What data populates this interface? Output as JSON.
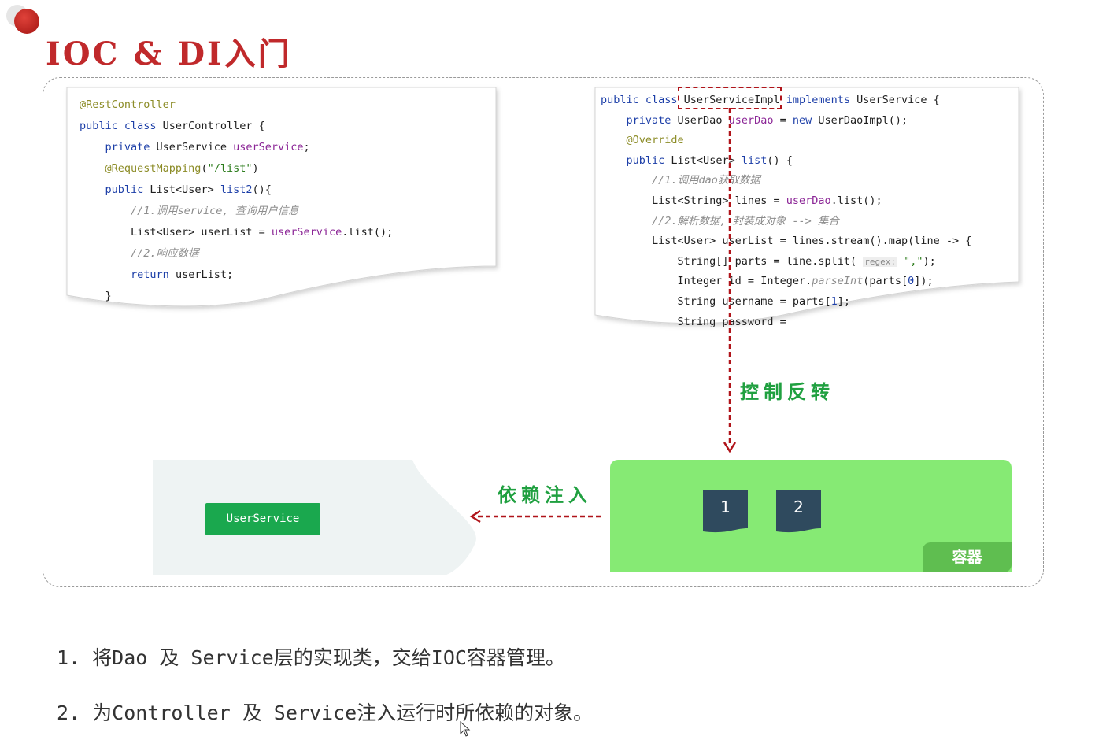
{
  "title": "IOC & DI入门",
  "left_code": {
    "lines": [
      [
        {
          "c": "an",
          "t": "@RestController"
        }
      ],
      [
        {
          "c": "kw",
          "t": "public class "
        },
        {
          "c": "",
          "t": "UserController {"
        }
      ],
      [
        {
          "c": "",
          "t": "    "
        },
        {
          "c": "kw",
          "t": "private "
        },
        {
          "c": "",
          "t": "UserService "
        },
        {
          "c": "fld",
          "t": "userService"
        },
        {
          "c": "",
          "t": ";"
        }
      ],
      [
        {
          "c": "",
          "t": "    "
        },
        {
          "c": "an",
          "t": "@RequestMapping"
        },
        {
          "c": "",
          "t": "("
        },
        {
          "c": "str",
          "t": "\"/list\""
        },
        {
          "c": "",
          "t": ")"
        }
      ],
      [
        {
          "c": "",
          "t": "    "
        },
        {
          "c": "kw",
          "t": "public "
        },
        {
          "c": "",
          "t": "List<User> "
        },
        {
          "c": "kw",
          "t": "list2"
        },
        {
          "c": "",
          "t": "(){"
        }
      ],
      [
        {
          "c": "",
          "t": "        "
        },
        {
          "c": "cm",
          "t": "//1.调用service, 查询用户信息"
        }
      ],
      [
        {
          "c": "",
          "t": "        List<User> userList = "
        },
        {
          "c": "fld",
          "t": "userService"
        },
        {
          "c": "",
          "t": ".list();"
        }
      ],
      [
        {
          "c": "",
          "t": "        "
        },
        {
          "c": "cm",
          "t": "//2.响应数据"
        }
      ],
      [
        {
          "c": "",
          "t": "        "
        },
        {
          "c": "kw",
          "t": "return "
        },
        {
          "c": "",
          "t": "userList;"
        }
      ],
      [
        {
          "c": "",
          "t": "    }"
        }
      ]
    ]
  },
  "right_code": {
    "highlight": "UserServiceImpl",
    "lines": [
      [
        {
          "c": "kw",
          "t": "public class "
        },
        {
          "c": "",
          "t": "UserServiceImpl "
        },
        {
          "c": "kw",
          "t": "implements "
        },
        {
          "c": "",
          "t": "UserService {"
        }
      ],
      [
        {
          "c": "",
          "t": "    "
        },
        {
          "c": "kw",
          "t": "private "
        },
        {
          "c": "",
          "t": "UserDao "
        },
        {
          "c": "fld",
          "t": "userDao"
        },
        {
          "c": "",
          "t": " = "
        },
        {
          "c": "kw",
          "t": "new "
        },
        {
          "c": "",
          "t": "UserDaoImpl();"
        }
      ],
      [
        {
          "c": "",
          "t": "    "
        },
        {
          "c": "an",
          "t": "@Override"
        }
      ],
      [
        {
          "c": "",
          "t": "    "
        },
        {
          "c": "kw",
          "t": "public "
        },
        {
          "c": "",
          "t": "List<User> "
        },
        {
          "c": "kw",
          "t": "list"
        },
        {
          "c": "",
          "t": "() {"
        }
      ],
      [
        {
          "c": "",
          "t": "        "
        },
        {
          "c": "cm",
          "t": "//1.调用dao获取数据"
        }
      ],
      [
        {
          "c": "",
          "t": "        List<String> lines = "
        },
        {
          "c": "fld",
          "t": "userDao"
        },
        {
          "c": "",
          "t": ".list();"
        }
      ],
      [
        {
          "c": "",
          "t": "        "
        },
        {
          "c": "cm",
          "t": "//2.解析数据, 封装成对象 --> 集合"
        }
      ],
      [
        {
          "c": "",
          "t": "        List<User> userList = lines.stream().map(line -> {"
        }
      ],
      [
        {
          "c": "",
          "t": "            String[] parts = line.split( "
        },
        {
          "c": "hint",
          "t": "regex:"
        },
        {
          "c": "",
          "t": " "
        },
        {
          "c": "str",
          "t": "\",\""
        },
        {
          "c": "",
          "t": ");"
        }
      ],
      [
        {
          "c": "",
          "t": "            Integer id = Integer."
        },
        {
          "c": "cm",
          "t": "parseInt"
        },
        {
          "c": "",
          "t": "(parts["
        },
        {
          "c": "num",
          "t": "0"
        },
        {
          "c": "",
          "t": "]);"
        }
      ],
      [
        {
          "c": "",
          "t": "            String username = parts["
        },
        {
          "c": "num",
          "t": "1"
        },
        {
          "c": "",
          "t": "];"
        }
      ],
      [
        {
          "c": "",
          "t": "            String password = "
        }
      ]
    ]
  },
  "labels": {
    "ioc": "控制反转",
    "di": "依赖注入",
    "service_badge": "UserService",
    "container_tag": "容器",
    "bean1": "1",
    "bean2": "2"
  },
  "bullets": [
    "1. 将Dao 及 Service层的实现类，交给IOC容器管理。",
    "2. 为Controller 及 Service注入运行时所依赖的对象。"
  ],
  "colors": {
    "title": "#c0292b",
    "arrow": "#b0141a",
    "label": "#20a040",
    "container": "#86ea74",
    "container_tag": "#5fbe50",
    "badge": "#1aa84e",
    "bean": "#2f4a5e"
  }
}
